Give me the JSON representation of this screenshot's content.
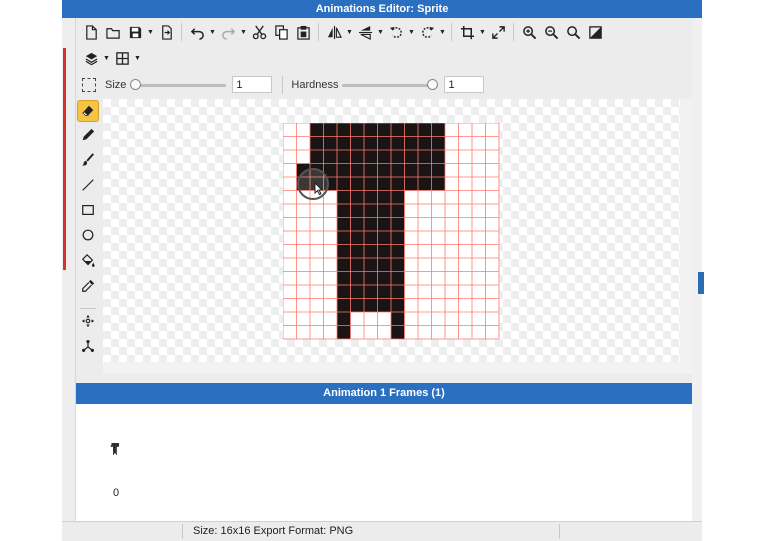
{
  "window": {
    "title": "Animations Editor: Sprite"
  },
  "toolbar": {
    "row1": [
      {
        "icon": "new-file-icon"
      },
      {
        "icon": "open-folder-icon"
      },
      {
        "icon": "save-icon",
        "dropdown": true
      },
      {
        "icon": "export-icon"
      },
      {
        "sep": true
      },
      {
        "icon": "undo-icon",
        "dropdown": true
      },
      {
        "icon": "redo-icon",
        "dropdown": true
      },
      {
        "icon": "cut-icon"
      },
      {
        "icon": "copy-icon"
      },
      {
        "icon": "paste-icon"
      },
      {
        "sep": true
      },
      {
        "icon": "flip-horizontal-icon",
        "dropdown": true
      },
      {
        "icon": "flip-vertical-icon",
        "dropdown": true
      },
      {
        "icon": "rotate-ccw-icon",
        "dropdown": true
      },
      {
        "icon": "rotate-cw-icon",
        "dropdown": true
      },
      {
        "sep": true
      },
      {
        "icon": "crop-icon",
        "dropdown": true
      },
      {
        "icon": "resize-icon"
      },
      {
        "sep": true
      },
      {
        "icon": "zoom-in-icon"
      },
      {
        "icon": "zoom-out-icon"
      },
      {
        "icon": "zoom-fit-icon"
      },
      {
        "icon": "invert-icon"
      }
    ],
    "row2": [
      {
        "icon": "layers-icon",
        "dropdown": true
      },
      {
        "icon": "grid-icon",
        "dropdown": true
      }
    ]
  },
  "options": {
    "size_label": "Size",
    "size_value": "1",
    "size_fraction": 0,
    "hardness_label": "Hardness",
    "hardness_value": "1",
    "hardness_fraction": 1
  },
  "tools": [
    {
      "icon": "eraser-icon",
      "active": true
    },
    {
      "icon": "pencil-icon"
    },
    {
      "icon": "brush-icon"
    },
    {
      "icon": "line-icon"
    },
    {
      "icon": "rectangle-icon"
    },
    {
      "icon": "ellipse-icon"
    },
    {
      "icon": "fill-bucket-icon"
    },
    {
      "icon": "eyedropper-icon"
    },
    {
      "icon": "move-point-icon"
    },
    {
      "icon": "skeleton-icon"
    }
  ],
  "sprite": {
    "size": 16,
    "pixels": [
      "..##########....",
      "..##########....",
      "..##########....",
      ".###########....",
      ".###########....",
      "....#####.......",
      "....#####.......",
      "....#####.......",
      "....#####.......",
      "....#####.......",
      "....#####.......",
      "....#####.......",
      "....#####.......",
      "....#####.......",
      "....#...#.......",
      "....#...#......."
    ],
    "fill_color": "#1a1414",
    "grid_color": "#ff7a6e"
  },
  "frames_panel": {
    "title": "Animation 1 Frames (1)",
    "frames": [
      {
        "number": "0"
      }
    ]
  },
  "status": {
    "text": "Size: 16x16   Export Format: PNG"
  }
}
